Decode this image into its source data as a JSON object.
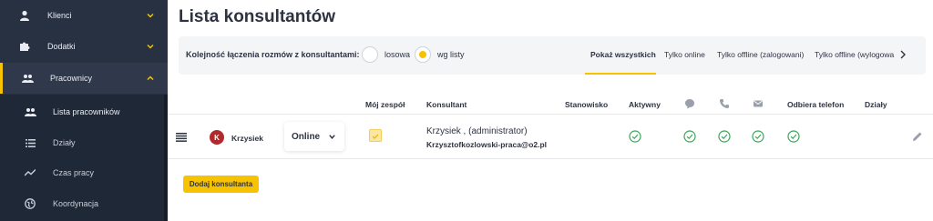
{
  "sidebar": {
    "items": [
      {
        "label": "Klienci",
        "icon": "person-icon"
      },
      {
        "label": "Dodatki",
        "icon": "puzzle-icon"
      },
      {
        "label": "Pracownicy",
        "icon": "group-icon"
      }
    ],
    "sub_items": [
      {
        "label": "Lista pracowników",
        "icon": "group-icon"
      },
      {
        "label": "Działy",
        "icon": "list-icon"
      },
      {
        "label": "Czas pracy",
        "icon": "trend-icon"
      },
      {
        "label": "Koordynacja",
        "icon": "globe-icon"
      }
    ]
  },
  "page": {
    "title": "Lista konsultantów"
  },
  "order": {
    "label": "Kolejność łączenia rozmów z konsultantami:",
    "options": [
      {
        "label": "losowa",
        "selected": false
      },
      {
        "label": "wg listy",
        "selected": true
      }
    ]
  },
  "tabs": [
    {
      "label": "Pokaż wszystkich",
      "active": true
    },
    {
      "label": "Tylko online",
      "active": false
    },
    {
      "label": "Tylko offline (zalogowani)",
      "active": false
    },
    {
      "label": "Tylko offline (wylogowa",
      "active": false
    }
  ],
  "table": {
    "headers": {
      "team": "Mój zespół",
      "consultant": "Konsultant",
      "position": "Stanowisko",
      "active": "Aktywny",
      "phone_answer": "Odbiera telefon",
      "departments": "Działy"
    },
    "header_icons": [
      "chat-icon",
      "phone-icon",
      "mail-icon"
    ],
    "rows": [
      {
        "avatar_letter": "K",
        "user": "Krzysiek",
        "status": "Online",
        "my_team": true,
        "consultant_name": "Krzysiek , (administrator)",
        "consultant_email": "Krzysztofkozlowski-praca@o2.pl",
        "position": "",
        "active": true,
        "chat": true,
        "phone": true,
        "mail": true,
        "answers_phone": true
      }
    ]
  },
  "actions": {
    "add_consultant": "Dodaj konsultanta"
  },
  "colors": {
    "accent": "#f7c300",
    "sidebar": "#273142",
    "ok": "#3aa757",
    "avatar": "#b3282d"
  }
}
